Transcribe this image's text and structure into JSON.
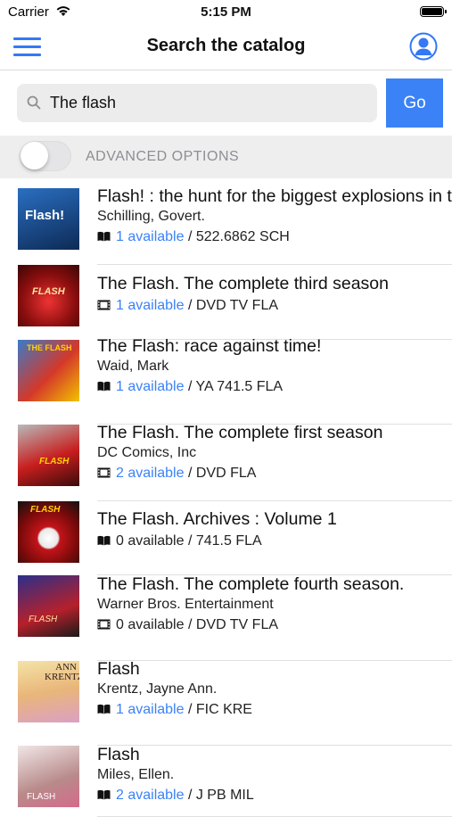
{
  "status_bar": {
    "carrier": "Carrier",
    "time": "5:15 PM"
  },
  "navbar": {
    "title": "Search the catalog",
    "menu_icon": "hamburger-menu-icon",
    "profile_icon": "user-profile-icon"
  },
  "search": {
    "value": "The flash",
    "go_label": "Go"
  },
  "advanced": {
    "label": "ADVANCED OPTIONS",
    "enabled": false
  },
  "colors": {
    "accent": "#3b82f6",
    "link": "#3b82f6"
  },
  "results": [
    {
      "title": "Flash! : the hunt for the biggest explosions in the universe",
      "author": "Schilling, Govert.",
      "type": "book",
      "available": "1 available",
      "available_link": true,
      "call_number": "522.6862 SCH",
      "cover_text": "Flash!"
    },
    {
      "title": "The Flash. The complete third season",
      "author": "",
      "type": "dvd",
      "available": "1 available",
      "available_link": true,
      "call_number": "DVD TV FLA",
      "cover_text": "FLASH"
    },
    {
      "title": "The Flash: race against time!",
      "author": "Waid, Mark",
      "type": "book",
      "available": "1 available",
      "available_link": true,
      "call_number": "YA 741.5 FLA",
      "cover_text": "THE FLASH"
    },
    {
      "title": "The Flash. The complete first season",
      "author": "DC Comics, Inc",
      "type": "dvd",
      "available": "2 available",
      "available_link": true,
      "call_number": "DVD FLA",
      "cover_text": "FLASH"
    },
    {
      "title": "The Flash. Archives : Volume 1",
      "author": "",
      "type": "book",
      "available": "0 available",
      "available_link": false,
      "call_number": "741.5 FLA",
      "cover_text": "FLASH"
    },
    {
      "title": "The Flash. The complete fourth season.",
      "author": "Warner Bros. Entertainment",
      "type": "dvd",
      "available": "0 available",
      "available_link": false,
      "call_number": "DVD TV FLA",
      "cover_text": "FLASH"
    },
    {
      "title": "Flash",
      "author": "Krentz, Jayne Ann.",
      "type": "book",
      "available": "1 available",
      "available_link": true,
      "call_number": "FIC KRE",
      "cover_text": "ANN KRENTZ"
    },
    {
      "title": "Flash",
      "author": "Miles, Ellen.",
      "type": "book",
      "available": "2 available",
      "available_link": true,
      "call_number": "J PB MIL",
      "cover_text": "FLASH"
    }
  ]
}
